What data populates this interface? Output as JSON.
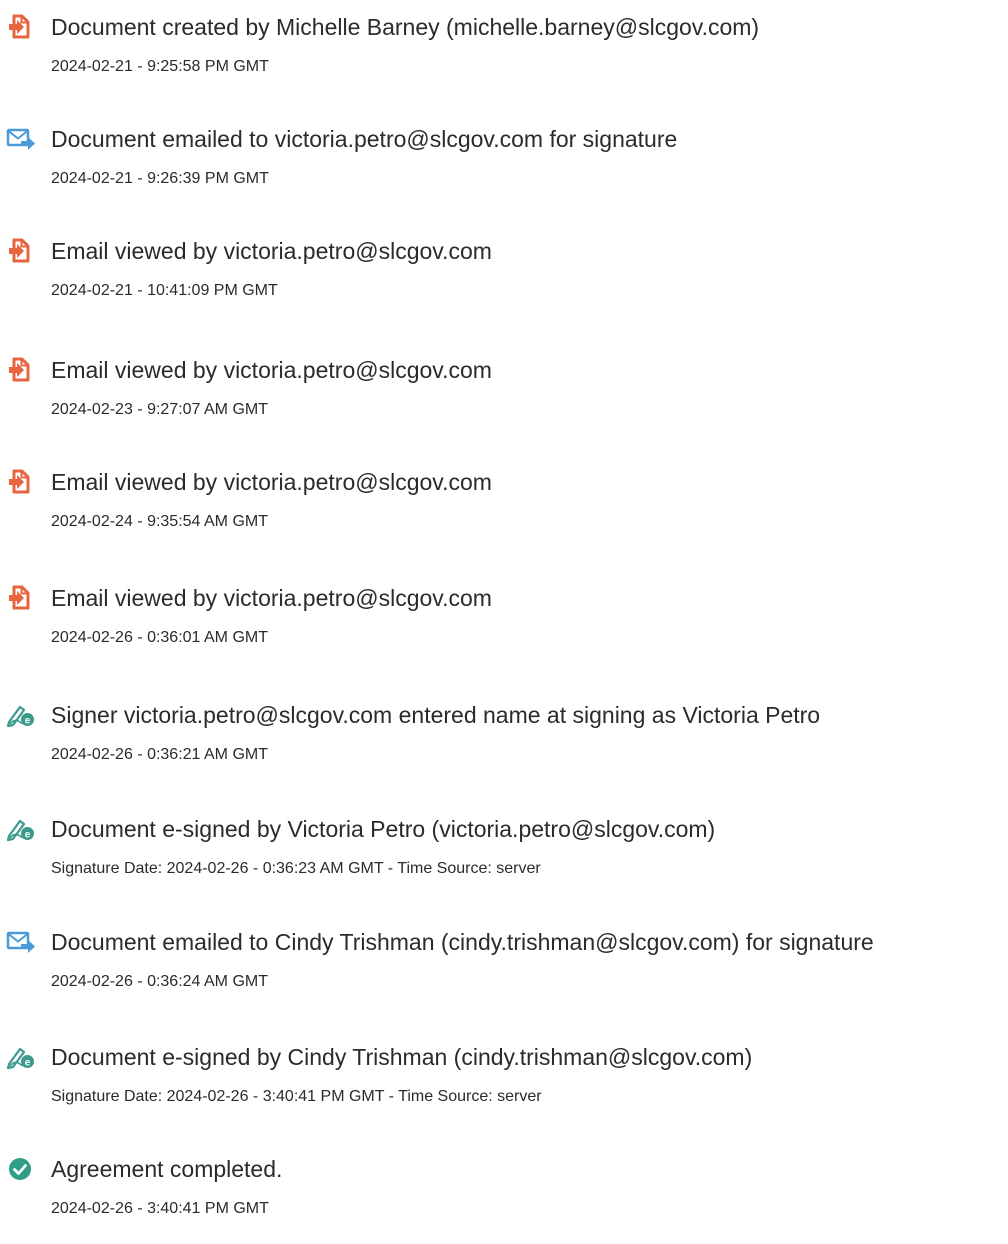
{
  "events": [
    {
      "icon": "document-created-icon",
      "title": "Document created by Michelle Barney (michelle.barney@slcgov.com)",
      "detail": "2024-02-21 - 9:25:58 PM GMT"
    },
    {
      "icon": "email-sent-icon",
      "title": "Document emailed to victoria.petro@slcgov.com for signature",
      "detail": "2024-02-21 - 9:26:39 PM GMT"
    },
    {
      "icon": "document-viewed-icon",
      "title": "Email viewed by victoria.petro@slcgov.com",
      "detail": "2024-02-21 - 10:41:09 PM GMT"
    },
    {
      "icon": "document-viewed-icon",
      "title": "Email viewed by victoria.petro@slcgov.com",
      "detail": "2024-02-23 - 9:27:07 AM GMT"
    },
    {
      "icon": "document-viewed-icon",
      "title": "Email viewed by victoria.petro@slcgov.com",
      "detail": "2024-02-24 - 9:35:54 AM GMT"
    },
    {
      "icon": "document-viewed-icon",
      "title": "Email viewed by victoria.petro@slcgov.com",
      "detail": "2024-02-26 - 0:36:01 AM GMT"
    },
    {
      "icon": "e-sign-icon",
      "title": "Signer victoria.petro@slcgov.com entered name at signing as Victoria Petro",
      "detail": "2024-02-26 - 0:36:21 AM GMT"
    },
    {
      "icon": "e-sign-icon",
      "title": "Document e-signed by Victoria Petro (victoria.petro@slcgov.com)",
      "detail": "Signature Date: 2024-02-26 - 0:36:23 AM GMT - Time Source: server"
    },
    {
      "icon": "email-sent-icon",
      "title": "Document emailed to Cindy Trishman (cindy.trishman@slcgov.com) for signature",
      "detail": "2024-02-26 - 0:36:24 AM GMT"
    },
    {
      "icon": "e-sign-icon",
      "title": "Document e-signed by Cindy Trishman (cindy.trishman@slcgov.com)",
      "detail": "Signature Date: 2024-02-26 - 3:40:41 PM GMT - Time Source: server"
    },
    {
      "icon": "check-circle-icon",
      "title": "Agreement completed.",
      "detail": "2024-02-26 - 3:40:41 PM GMT"
    }
  ],
  "colors": {
    "document_icon": "#e8643f",
    "email_icon": "#4a9ad8",
    "sign_icon": "#3c9a8c",
    "check_icon": "#2f9e86",
    "text": "#2b2b2b"
  }
}
